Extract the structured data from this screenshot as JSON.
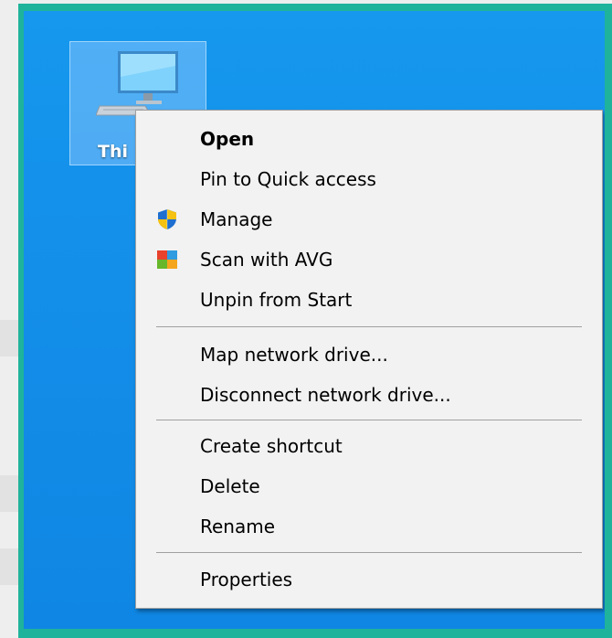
{
  "desktop": {
    "icon": {
      "name": "This PC",
      "visible_label": "Thi"
    }
  },
  "context_menu": {
    "items": [
      {
        "label": "Open",
        "bold": true,
        "icon": null
      },
      {
        "label": "Pin to Quick access",
        "icon": null
      },
      {
        "label": "Manage",
        "icon": "shield-icon"
      },
      {
        "label": "Scan with AVG",
        "icon": "avg-icon"
      },
      {
        "label": "Unpin from Start",
        "icon": null
      },
      {
        "label": "Map network drive...",
        "icon": null
      },
      {
        "label": "Disconnect network drive...",
        "icon": null
      },
      {
        "label": "Create shortcut",
        "icon": null
      },
      {
        "label": "Delete",
        "icon": null
      },
      {
        "label": "Rename",
        "icon": null
      },
      {
        "label": "Properties",
        "icon": null
      }
    ]
  },
  "colors": {
    "frame_accent": "#1fb39b",
    "desktop_blue": "#138ee9",
    "menu_background": "#f2f2f2",
    "separator": "#a0a0a0"
  }
}
